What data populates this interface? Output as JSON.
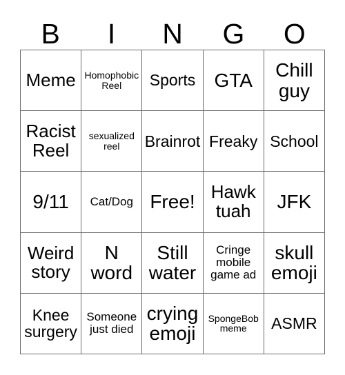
{
  "card": {
    "title": "BINGO",
    "headers": [
      "B",
      "I",
      "N",
      "G",
      "O"
    ],
    "colors": {
      "background": "#ffffff",
      "text": "#000000",
      "border": "#6b6b6b"
    },
    "grid_size": "5x5",
    "rows": [
      [
        {
          "text": "Meme",
          "size": "lg",
          "lines": 1
        },
        {
          "text": "Homophobic\nReel",
          "size": "xs",
          "lines": 2
        },
        {
          "text": "Sports",
          "size": "md",
          "lines": 1
        },
        {
          "text": "GTA",
          "size": "xl",
          "lines": 1
        },
        {
          "text": "Chill\nguy",
          "size": "xl",
          "lines": 2
        }
      ],
      [
        {
          "text": "Racist\nReel",
          "size": "lg",
          "lines": 2
        },
        {
          "text": "sexualized\nreel",
          "size": "xs",
          "lines": 2
        },
        {
          "text": "Brainrot",
          "size": "md",
          "lines": 1
        },
        {
          "text": "Freaky",
          "size": "md",
          "lines": 1
        },
        {
          "text": "School",
          "size": "md",
          "lines": 1
        }
      ],
      [
        {
          "text": "9/11",
          "size": "xl",
          "lines": 1
        },
        {
          "text": "Cat/Dog",
          "size": "sm",
          "lines": 1
        },
        {
          "text": "Free!",
          "size": "xl",
          "lines": 1
        },
        {
          "text": "Hawk\ntuah",
          "size": "lg",
          "lines": 2
        },
        {
          "text": "JFK",
          "size": "xl",
          "lines": 1
        }
      ],
      [
        {
          "text": "Weird\nstory",
          "size": "lg",
          "lines": 2
        },
        {
          "text": "N\nword",
          "size": "xl",
          "lines": 2
        },
        {
          "text": "Still\nwater",
          "size": "xl",
          "lines": 2
        },
        {
          "text": "Cringe\nmobile\ngame ad",
          "size": "sm",
          "lines": 3
        },
        {
          "text": "skull\nemoji",
          "size": "xl",
          "lines": 2
        }
      ],
      [
        {
          "text": "Knee\nsurgery",
          "size": "md",
          "lines": 2
        },
        {
          "text": "Someone\njust died",
          "size": "sm",
          "lines": 2
        },
        {
          "text": "crying\nemoji",
          "size": "xl",
          "lines": 2
        },
        {
          "text": "SpongeBob\nmeme",
          "size": "xs",
          "lines": 2
        },
        {
          "text": "ASMR",
          "size": "md",
          "lines": 1
        }
      ]
    ]
  }
}
